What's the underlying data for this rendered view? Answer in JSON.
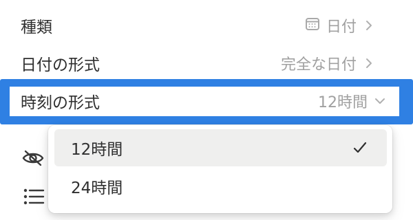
{
  "rows": {
    "type": {
      "label": "種類",
      "value": "日付",
      "icon": "calendar-icon"
    },
    "date_format": {
      "label": "日付の形式",
      "value": "完全な日付"
    },
    "time_format": {
      "label": "時刻の形式",
      "value": "12時間"
    }
  },
  "dropdown": {
    "options": [
      {
        "label": "12時間",
        "selected": true
      },
      {
        "label": "24時間",
        "selected": false
      }
    ]
  },
  "colors": {
    "highlight": "#2f80e3",
    "muted_text": "#a0a0a0",
    "selected_option_bg": "#efefee"
  },
  "icons": {
    "side_top": "eye-hidden-icon",
    "side_bottom": "list-icon",
    "row_arrow": "chevron-right-icon",
    "dropdown_arrow": "chevron-down-icon",
    "selected_mark": "checkmark-icon"
  }
}
